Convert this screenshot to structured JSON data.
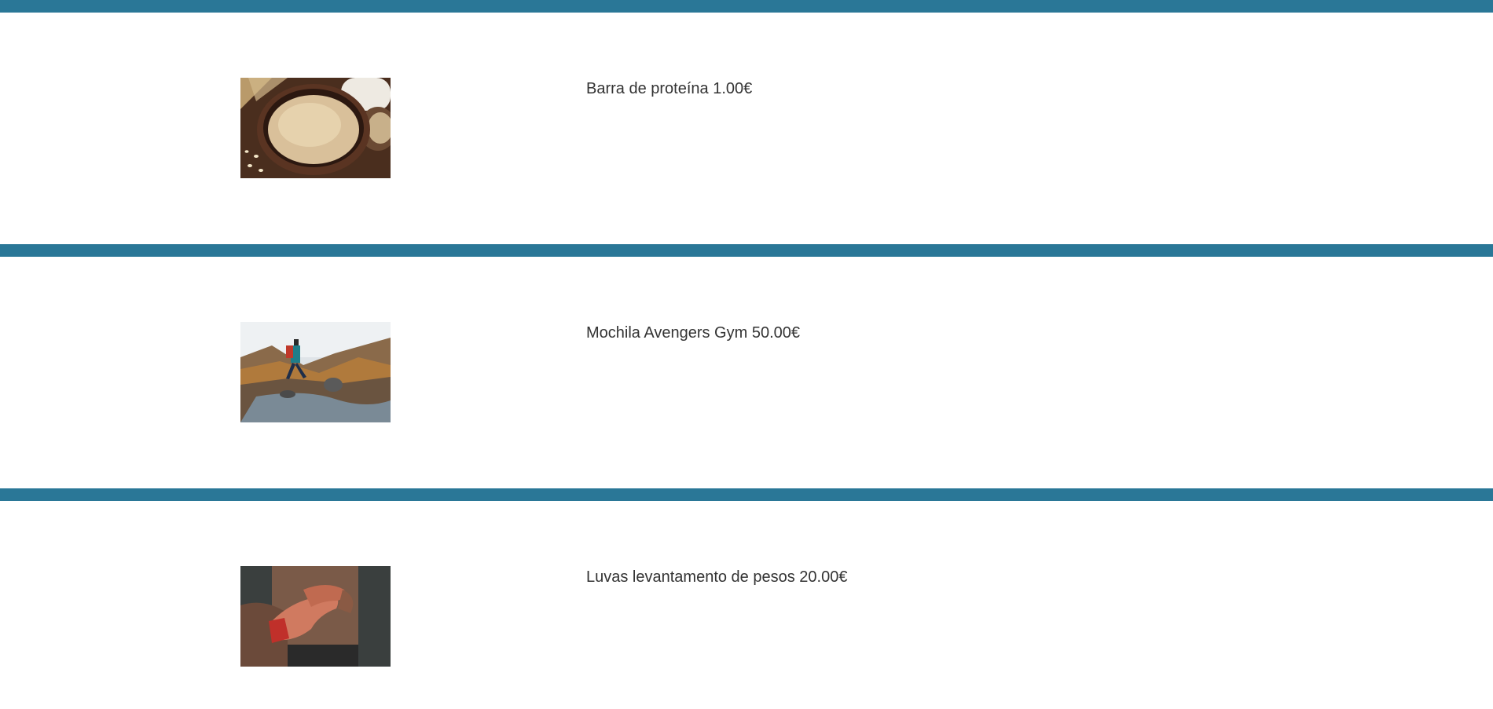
{
  "accent_color": "#2a7797",
  "products": [
    {
      "name": "Barra de proteína",
      "price": "1.00€",
      "image": "oats-bowl-image"
    },
    {
      "name": "Mochila Avengers Gym",
      "price": "50.00€",
      "image": "hiker-backpack-image"
    },
    {
      "name": "Luvas levantamento de pesos",
      "price": "20.00€",
      "image": "boxer-hand-wraps-image"
    }
  ]
}
